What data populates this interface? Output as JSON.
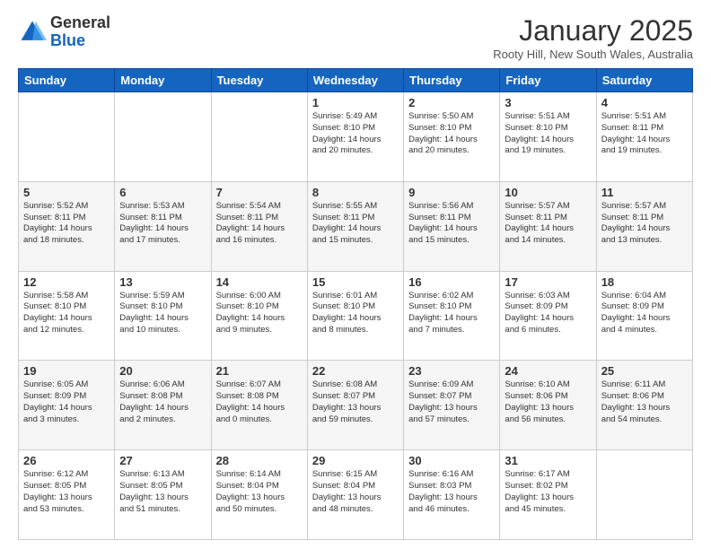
{
  "header": {
    "logo_general": "General",
    "logo_blue": "Blue",
    "month_title": "January 2025",
    "location": "Rooty Hill, New South Wales, Australia"
  },
  "days_of_week": [
    "Sunday",
    "Monday",
    "Tuesday",
    "Wednesday",
    "Thursday",
    "Friday",
    "Saturday"
  ],
  "weeks": [
    [
      {
        "day": "",
        "info": ""
      },
      {
        "day": "",
        "info": ""
      },
      {
        "day": "",
        "info": ""
      },
      {
        "day": "1",
        "info": "Sunrise: 5:49 AM\nSunset: 8:10 PM\nDaylight: 14 hours\nand 20 minutes."
      },
      {
        "day": "2",
        "info": "Sunrise: 5:50 AM\nSunset: 8:10 PM\nDaylight: 14 hours\nand 20 minutes."
      },
      {
        "day": "3",
        "info": "Sunrise: 5:51 AM\nSunset: 8:10 PM\nDaylight: 14 hours\nand 19 minutes."
      },
      {
        "day": "4",
        "info": "Sunrise: 5:51 AM\nSunset: 8:11 PM\nDaylight: 14 hours\nand 19 minutes."
      }
    ],
    [
      {
        "day": "5",
        "info": "Sunrise: 5:52 AM\nSunset: 8:11 PM\nDaylight: 14 hours\nand 18 minutes."
      },
      {
        "day": "6",
        "info": "Sunrise: 5:53 AM\nSunset: 8:11 PM\nDaylight: 14 hours\nand 17 minutes."
      },
      {
        "day": "7",
        "info": "Sunrise: 5:54 AM\nSunset: 8:11 PM\nDaylight: 14 hours\nand 16 minutes."
      },
      {
        "day": "8",
        "info": "Sunrise: 5:55 AM\nSunset: 8:11 PM\nDaylight: 14 hours\nand 15 minutes."
      },
      {
        "day": "9",
        "info": "Sunrise: 5:56 AM\nSunset: 8:11 PM\nDaylight: 14 hours\nand 15 minutes."
      },
      {
        "day": "10",
        "info": "Sunrise: 5:57 AM\nSunset: 8:11 PM\nDaylight: 14 hours\nand 14 minutes."
      },
      {
        "day": "11",
        "info": "Sunrise: 5:57 AM\nSunset: 8:11 PM\nDaylight: 14 hours\nand 13 minutes."
      }
    ],
    [
      {
        "day": "12",
        "info": "Sunrise: 5:58 AM\nSunset: 8:10 PM\nDaylight: 14 hours\nand 12 minutes."
      },
      {
        "day": "13",
        "info": "Sunrise: 5:59 AM\nSunset: 8:10 PM\nDaylight: 14 hours\nand 10 minutes."
      },
      {
        "day": "14",
        "info": "Sunrise: 6:00 AM\nSunset: 8:10 PM\nDaylight: 14 hours\nand 9 minutes."
      },
      {
        "day": "15",
        "info": "Sunrise: 6:01 AM\nSunset: 8:10 PM\nDaylight: 14 hours\nand 8 minutes."
      },
      {
        "day": "16",
        "info": "Sunrise: 6:02 AM\nSunset: 8:10 PM\nDaylight: 14 hours\nand 7 minutes."
      },
      {
        "day": "17",
        "info": "Sunrise: 6:03 AM\nSunset: 8:09 PM\nDaylight: 14 hours\nand 6 minutes."
      },
      {
        "day": "18",
        "info": "Sunrise: 6:04 AM\nSunset: 8:09 PM\nDaylight: 14 hours\nand 4 minutes."
      }
    ],
    [
      {
        "day": "19",
        "info": "Sunrise: 6:05 AM\nSunset: 8:09 PM\nDaylight: 14 hours\nand 3 minutes."
      },
      {
        "day": "20",
        "info": "Sunrise: 6:06 AM\nSunset: 8:08 PM\nDaylight: 14 hours\nand 2 minutes."
      },
      {
        "day": "21",
        "info": "Sunrise: 6:07 AM\nSunset: 8:08 PM\nDaylight: 14 hours\nand 0 minutes."
      },
      {
        "day": "22",
        "info": "Sunrise: 6:08 AM\nSunset: 8:07 PM\nDaylight: 13 hours\nand 59 minutes."
      },
      {
        "day": "23",
        "info": "Sunrise: 6:09 AM\nSunset: 8:07 PM\nDaylight: 13 hours\nand 57 minutes."
      },
      {
        "day": "24",
        "info": "Sunrise: 6:10 AM\nSunset: 8:06 PM\nDaylight: 13 hours\nand 56 minutes."
      },
      {
        "day": "25",
        "info": "Sunrise: 6:11 AM\nSunset: 8:06 PM\nDaylight: 13 hours\nand 54 minutes."
      }
    ],
    [
      {
        "day": "26",
        "info": "Sunrise: 6:12 AM\nSunset: 8:05 PM\nDaylight: 13 hours\nand 53 minutes."
      },
      {
        "day": "27",
        "info": "Sunrise: 6:13 AM\nSunset: 8:05 PM\nDaylight: 13 hours\nand 51 minutes."
      },
      {
        "day": "28",
        "info": "Sunrise: 6:14 AM\nSunset: 8:04 PM\nDaylight: 13 hours\nand 50 minutes."
      },
      {
        "day": "29",
        "info": "Sunrise: 6:15 AM\nSunset: 8:04 PM\nDaylight: 13 hours\nand 48 minutes."
      },
      {
        "day": "30",
        "info": "Sunrise: 6:16 AM\nSunset: 8:03 PM\nDaylight: 13 hours\nand 46 minutes."
      },
      {
        "day": "31",
        "info": "Sunrise: 6:17 AM\nSunset: 8:02 PM\nDaylight: 13 hours\nand 45 minutes."
      },
      {
        "day": "",
        "info": ""
      }
    ]
  ]
}
